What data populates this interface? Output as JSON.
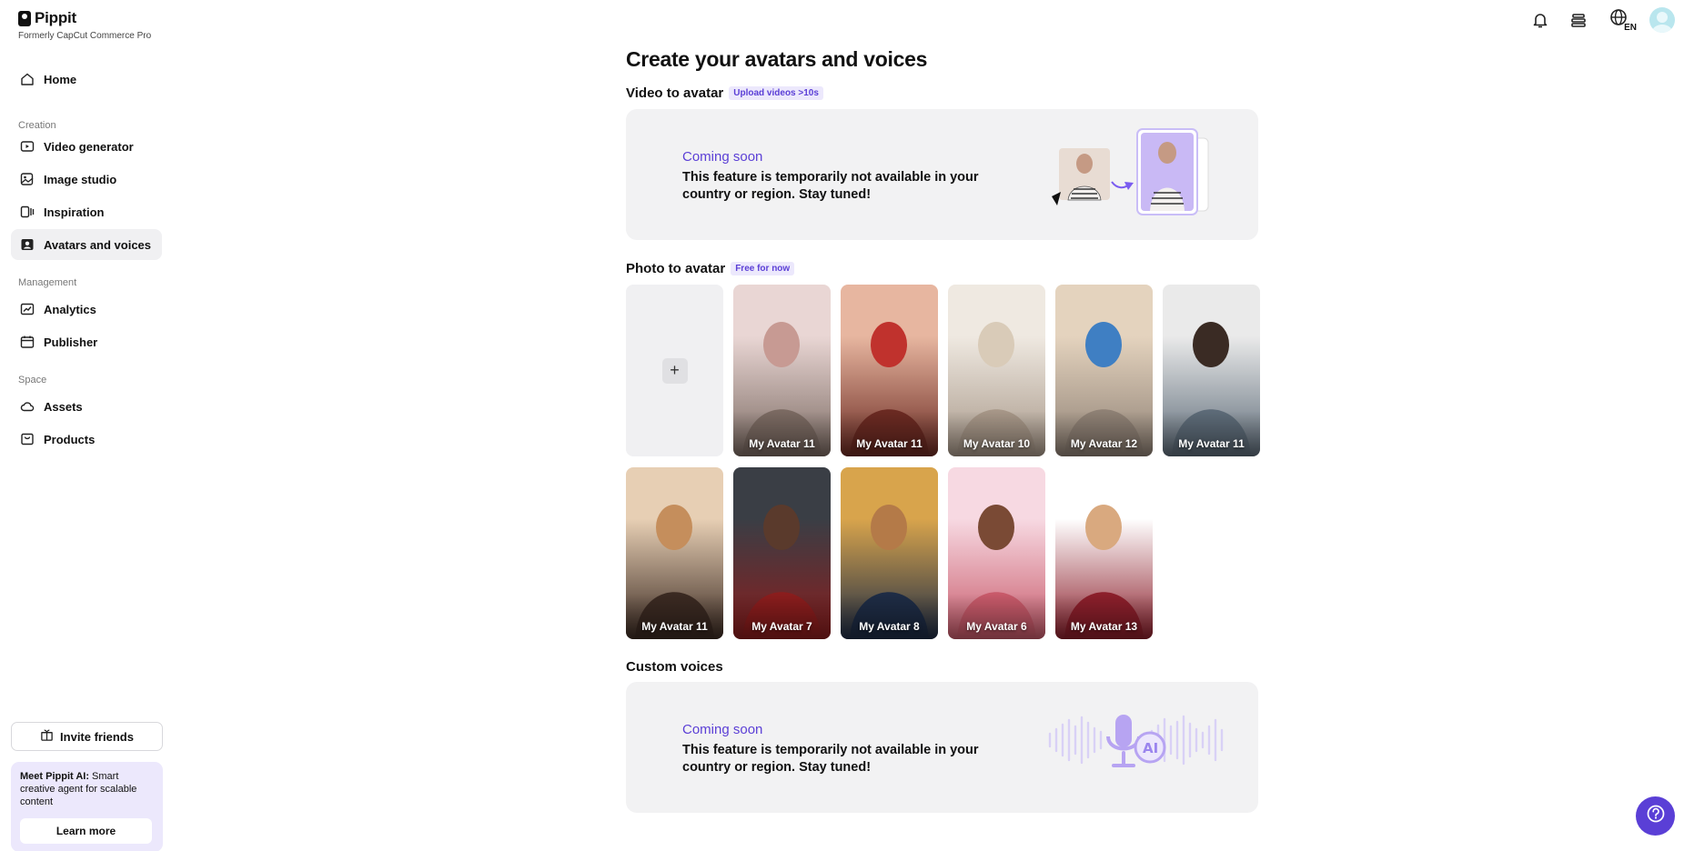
{
  "brand": {
    "name": "Pippit",
    "subtitle": "Formerly CapCut Commerce Pro"
  },
  "sidebar": {
    "home_label": "Home",
    "sections": {
      "creation": "Creation",
      "management": "Management",
      "space": "Space"
    },
    "items": {
      "video_generator": "Video generator",
      "image_studio": "Image studio",
      "inspiration": "Inspiration",
      "avatars_and_voices": "Avatars and voices",
      "analytics": "Analytics",
      "publisher": "Publisher",
      "assets": "Assets",
      "products": "Products"
    },
    "active_item": "Avatars and voices",
    "invite_label": "Invite friends",
    "promo": {
      "heading": "Meet Pippit AI:",
      "text": " Smart creative agent for scalable content",
      "button": "Learn more"
    }
  },
  "topbar": {
    "language_code": "EN",
    "icons": [
      "bell-icon",
      "stack-icon",
      "globe-icon",
      "user-avatar"
    ]
  },
  "main": {
    "title": "Create your avatars and voices",
    "video_to_avatar": {
      "label": "Video to avatar",
      "badge": "Upload videos >10s",
      "coming_title": "Coming soon",
      "coming_desc": "This feature is temporarily not available in your country or region. Stay tuned!"
    },
    "photo_to_avatar": {
      "label": "Photo to avatar",
      "badge": "Free for now",
      "add_symbol": "+",
      "avatars": [
        {
          "name": "My Avatar 11",
          "palette": [
            "#e9d6d4",
            "#c79a93",
            "#7b6a62"
          ]
        },
        {
          "name": "My Avatar 11",
          "palette": [
            "#e7b6a0",
            "#c0322d",
            "#6b2a22"
          ]
        },
        {
          "name": "My Avatar 10",
          "palette": [
            "#efe9e1",
            "#d9cbb8",
            "#a79788"
          ]
        },
        {
          "name": "My Avatar 12",
          "palette": [
            "#e4d3be",
            "#3f7fc3",
            "#8f8175"
          ]
        },
        {
          "name": "My Avatar 11",
          "palette": [
            "#eaeaea",
            "#3a2b24",
            "#5d6b78"
          ]
        },
        {
          "name": "My Avatar 11",
          "palette": [
            "#e7cfb4",
            "#c58e5c",
            "#3b2a22"
          ]
        },
        {
          "name": "My Avatar 7",
          "palette": [
            "#3a3e45",
            "#5a3a2c",
            "#8b1d1d"
          ]
        },
        {
          "name": "My Avatar 8",
          "palette": [
            "#d8a44c",
            "#b47a48",
            "#1e2c45"
          ]
        },
        {
          "name": "My Avatar 6",
          "palette": [
            "#f7d9e2",
            "#7a4a35",
            "#c85a6a"
          ]
        },
        {
          "name": "My Avatar 13",
          "palette": [
            "#ffffff",
            "#d9a97f",
            "#8c1f2b"
          ]
        }
      ]
    },
    "custom_voices": {
      "label": "Custom voices",
      "coming_title": "Coming soon",
      "coming_desc": "This feature is temporarily not available in your country or region. Stay tuned!"
    }
  },
  "colors": {
    "accent": "#5b3fd6",
    "card_bg": "#f2f2f3",
    "badge_bg": "#ece8fc"
  }
}
